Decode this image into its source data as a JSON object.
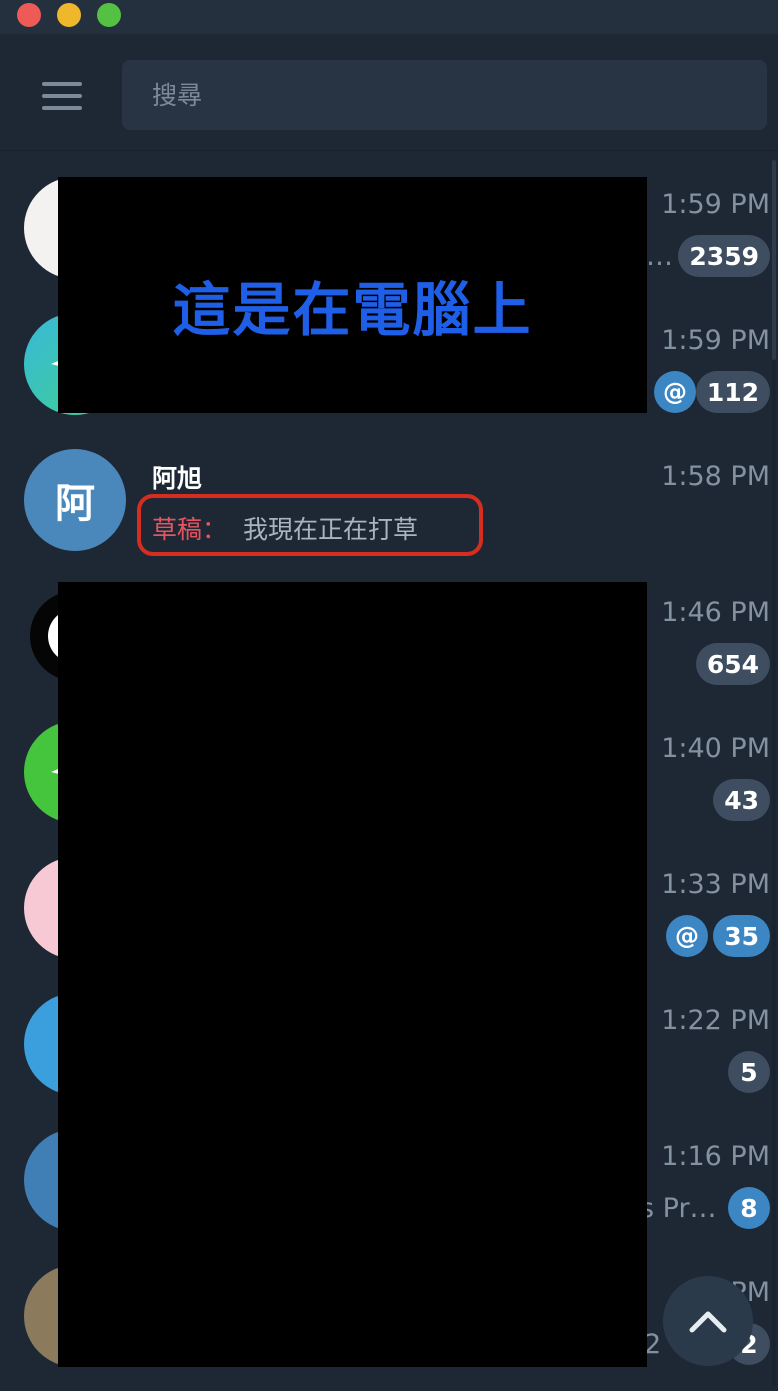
{
  "search": {
    "placeholder": "搜尋"
  },
  "overlay": {
    "text": "這是在電腦上"
  },
  "chats": [
    {
      "time": "1:59 PM",
      "preview": "…",
      "badge": "2359"
    },
    {
      "time": "1:59 PM",
      "mention": "@",
      "badge": "112"
    },
    {
      "name": "阿旭",
      "avatar_initial": "阿",
      "time": "1:58 PM",
      "draft_label": "草稿：",
      "draft_text": "我現在正在打草"
    },
    {
      "time": "1:46 PM",
      "badge": "654"
    },
    {
      "time": "1:40 PM",
      "badge": "43"
    },
    {
      "time": "1:33 PM",
      "mention": "@",
      "badge": "35"
    },
    {
      "time": "1:22 PM",
      "badge": "5"
    },
    {
      "time": "1:16 PM",
      "preview": "s Pr…",
      "badge": "8"
    },
    {
      "time": "1:..PM",
      "preview": "2",
      "badge": "2"
    }
  ],
  "colors": {
    "background": "#1e2835",
    "accent": "#3d86c4",
    "badge_muted": "#3e4d5f",
    "draft_red": "#e55460",
    "highlight_border": "#d62d20"
  },
  "icons": {
    "menu": "hamburger-menu-icon",
    "scroll_top": "chevron-up-icon"
  }
}
